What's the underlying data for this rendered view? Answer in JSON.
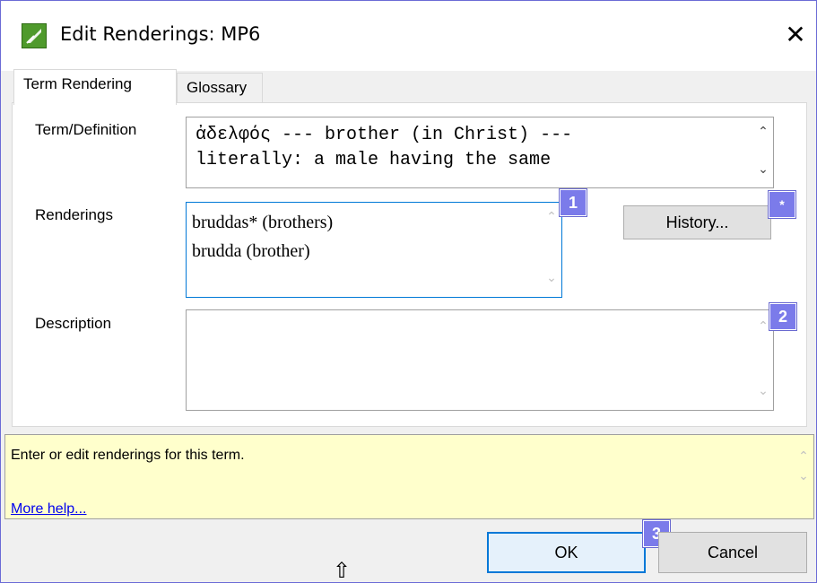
{
  "window": {
    "title": "Edit Renderings: MP6",
    "close_glyph": "✕"
  },
  "tabs": [
    {
      "label": "Term Rendering",
      "active": true
    },
    {
      "label": "Glossary",
      "active": false
    }
  ],
  "term": {
    "label": "Term/Definition",
    "lines": [
      "ἀδελφός --- brother (in Christ) ---",
      "literally: a male having the same"
    ]
  },
  "renderings": {
    "label": "Renderings",
    "items": [
      "bruddas* (brothers)",
      "brudda (brother)"
    ],
    "history_button": "History..."
  },
  "description": {
    "label": "Description",
    "value": ""
  },
  "badges": {
    "renderings": "1",
    "history": "*",
    "description": "2",
    "ok": "3"
  },
  "help": {
    "text": "Enter or edit renderings for this term.",
    "link": "More help..."
  },
  "buttons": {
    "ok": "OK",
    "cancel": "Cancel"
  },
  "scroll_glyphs": {
    "up": "⌃",
    "down": "⌄"
  },
  "cursor_glyph": "⇧",
  "colors": {
    "accent": "#0078d7",
    "badge": "#7b7bea",
    "help_background": "#ffffcc",
    "link": "#0000ee"
  }
}
